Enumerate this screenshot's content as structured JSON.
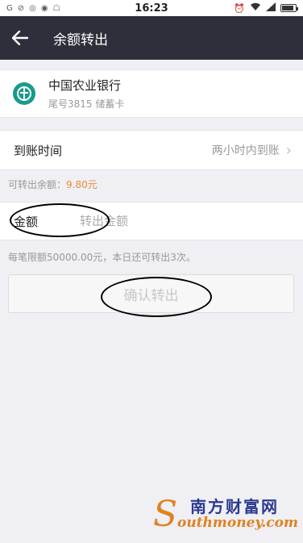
{
  "status_bar": {
    "left_icons": [
      "G",
      "⊘",
      "◎",
      "◉",
      "☖"
    ],
    "time": "16:23",
    "battery_level": 0.85
  },
  "nav": {
    "title": "余额转出"
  },
  "bank": {
    "name": "中国农业银行",
    "sub": "尾号3815 储蓄卡",
    "logo_color": "#1a9a8a"
  },
  "arrival": {
    "label": "到账时间",
    "value": "两小时内到账"
  },
  "balance": {
    "label": "可转出余额：",
    "amount": "9.80元",
    "amount_color": "#f08a3c"
  },
  "amount_field": {
    "label": "金额",
    "placeholder": "转出金额",
    "value": ""
  },
  "limit_note": "每笔限额50000.00元，本日还可转出3次。",
  "confirm_button": "确认转出",
  "watermark": {
    "cn": "南方财富网",
    "en": "outhmoney.com"
  }
}
